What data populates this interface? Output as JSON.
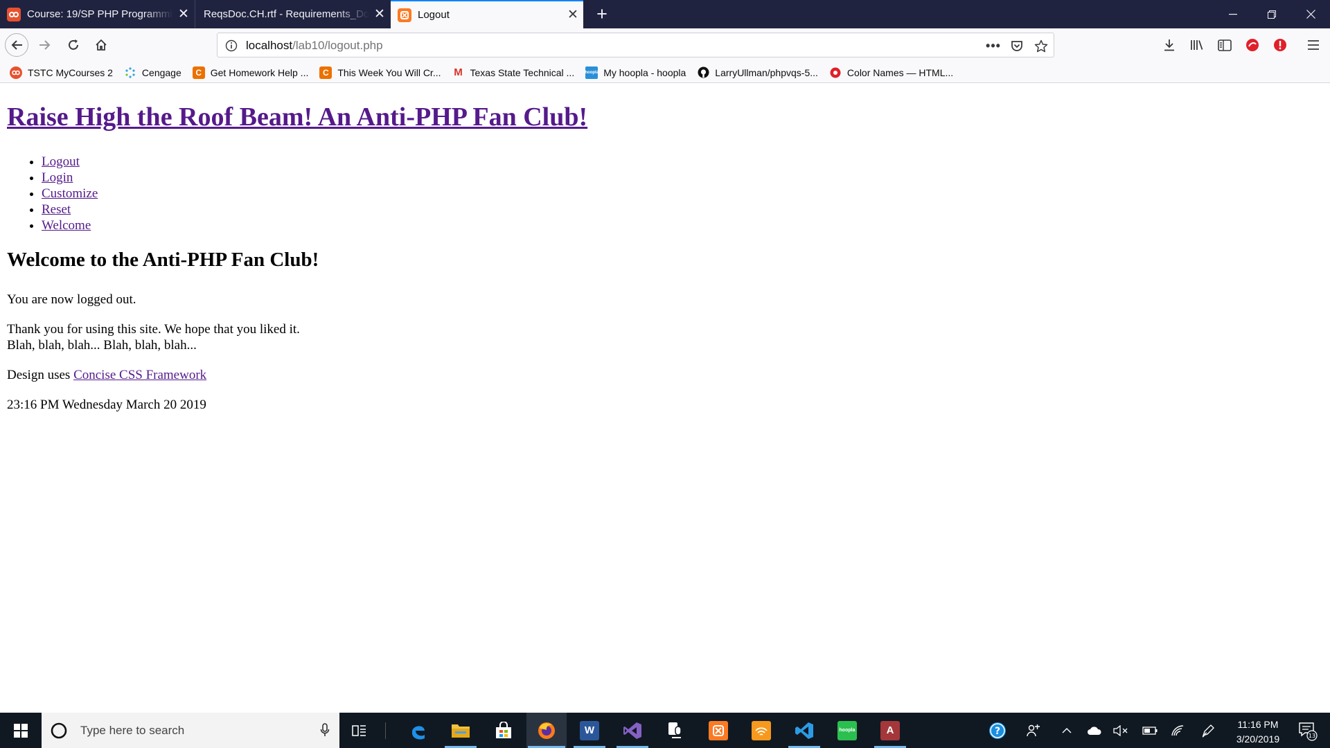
{
  "browser": {
    "tabs": [
      {
        "title": "Course: 19/SP PHP Programmin",
        "icon": "course-icon"
      },
      {
        "title": "ReqsDoc.CH.rtf - Requirements_Do",
        "icon": "doc-icon"
      },
      {
        "title": "Logout",
        "icon": "xampp-icon",
        "active": true
      }
    ],
    "url_host": "localhost",
    "url_path": "/lab10/logout.php",
    "bookmarks": [
      {
        "label": "TSTC MyCourses 2",
        "icon": "tstc-icon"
      },
      {
        "label": "Cengage",
        "icon": "cengage-icon"
      },
      {
        "label": "Get Homework Help ...",
        "icon": "chegg-icon"
      },
      {
        "label": "This Week You Will Cr...",
        "icon": "chegg-icon"
      },
      {
        "label": "Texas State Technical ...",
        "icon": "gmail-icon"
      },
      {
        "label": "My hoopla - hoopla",
        "icon": "hoopla-icon"
      },
      {
        "label": "LarryUllman/phpvqs-5...",
        "icon": "github-icon"
      },
      {
        "label": "Color Names — HTML...",
        "icon": "color-names-icon"
      }
    ]
  },
  "page": {
    "site_title": "Raise High the Roof Beam! An Anti-PHP Fan Club!",
    "nav": [
      "Logout",
      "Login",
      "Customize",
      "Reset",
      "Welcome"
    ],
    "heading": "Welcome to the Anti-PHP Fan Club!",
    "logged_out_message": "You are now logged out.",
    "thanks_line1": "Thank you for using this site. We hope that you liked it.",
    "thanks_line2": "Blah, blah, blah... Blah, blah, blah...",
    "design_prefix": "Design uses ",
    "design_link": "Concise CSS Framework",
    "timestamp": "23:16 PM Wednesday March 20 2019"
  },
  "taskbar": {
    "search_placeholder": "Type here to search",
    "clock_time": "11:16 PM",
    "clock_date": "3/20/2019",
    "notification_count": "13"
  },
  "colors": {
    "tabbar_bg": "#202340",
    "active_tab_accent": "#0a84ff",
    "visited_link": "#551a8b",
    "taskbar_bg": "#101922"
  }
}
